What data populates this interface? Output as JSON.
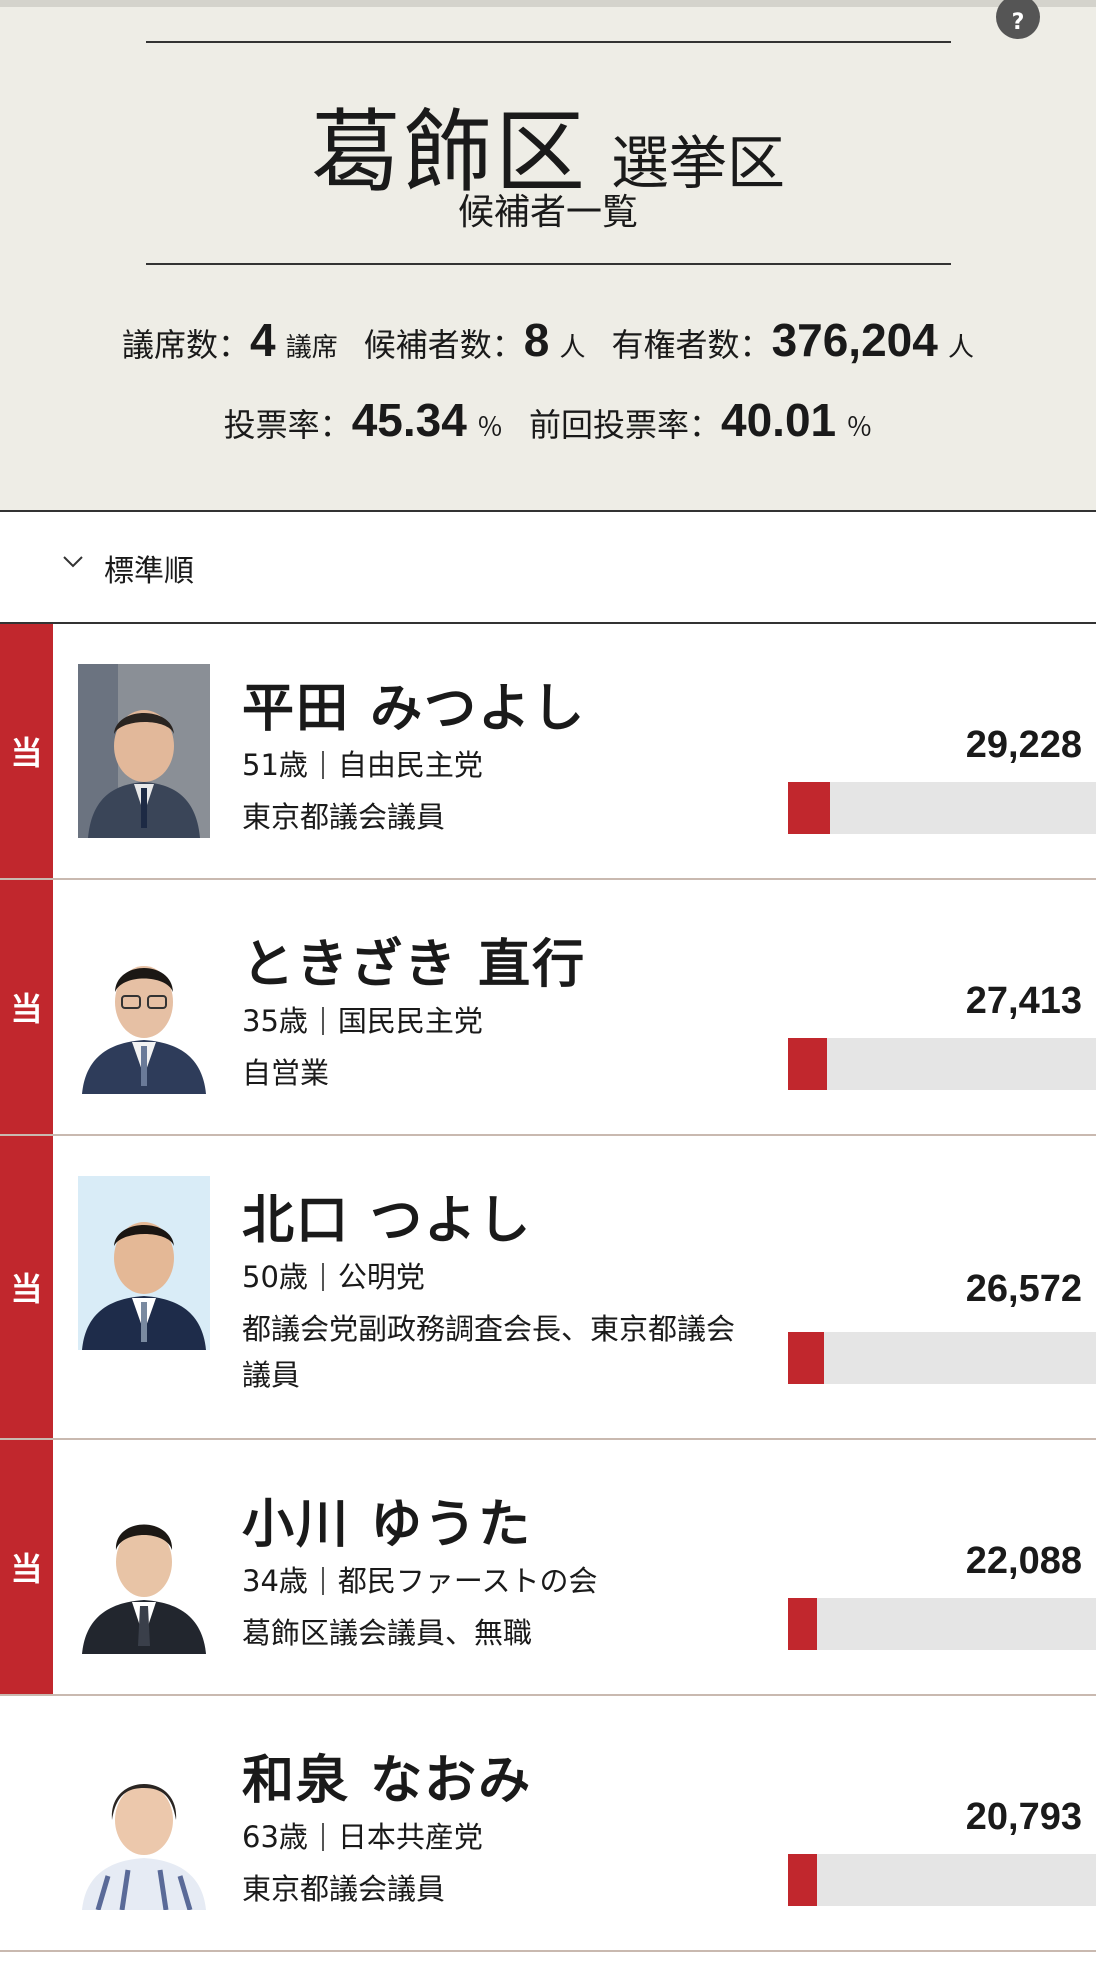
{
  "header": {
    "district": "葛飾区",
    "district_suffix": "選挙区",
    "subtitle": "候補者一覧",
    "help_label": "?",
    "seats_label": "議席数：",
    "seats_value": "4",
    "seats_unit": "議席",
    "candidates_label": "候補者数：",
    "candidates_value": "8",
    "candidates_unit": "人",
    "voters_label": "有権者数：",
    "voters_value": "376,204",
    "voters_unit": "人",
    "turnout_label": "投票率：",
    "turnout_value": "45.34",
    "turnout_unit": "％",
    "prev_turnout_label": "前回投票率：",
    "prev_turnout_value": "40.01",
    "prev_turnout_unit": "％"
  },
  "sort": {
    "label": "標準順"
  },
  "candidates": [
    {
      "elected": "当",
      "name": "平田 みつよし",
      "age": "51歳",
      "party": "自由民主党",
      "career": "東京都議会議員",
      "votes": "29,228",
      "vote_fraction": 0.135
    },
    {
      "elected": "当",
      "name": "ときざき 直行",
      "age": "35歳",
      "party": "国民民主党",
      "career": "自営業",
      "votes": "27,413",
      "vote_fraction": 0.126
    },
    {
      "elected": "当",
      "name": "北口 つよし",
      "age": "50歳",
      "party": "公明党",
      "career": "都議会党副政務調査会長、東京都議会議員",
      "votes": "26,572",
      "vote_fraction": 0.118
    },
    {
      "elected": "当",
      "name": "小川 ゆうた",
      "age": "34歳",
      "party": "都民ファーストの会",
      "career": "葛飾区議会議員、無職",
      "votes": "22,088",
      "vote_fraction": 0.095
    },
    {
      "elected": "",
      "name": "和泉 なおみ",
      "age": "63歳",
      "party": "日本共産党",
      "career": "東京都議会議員",
      "votes": "20,793",
      "vote_fraction": 0.093
    }
  ],
  "colors": {
    "accent": "#c1272d",
    "header_bg": "#eeede6",
    "bar_track": "#e5e5e5"
  },
  "icons": {
    "sort": "chevron-down-icon",
    "help": "question-icon"
  }
}
